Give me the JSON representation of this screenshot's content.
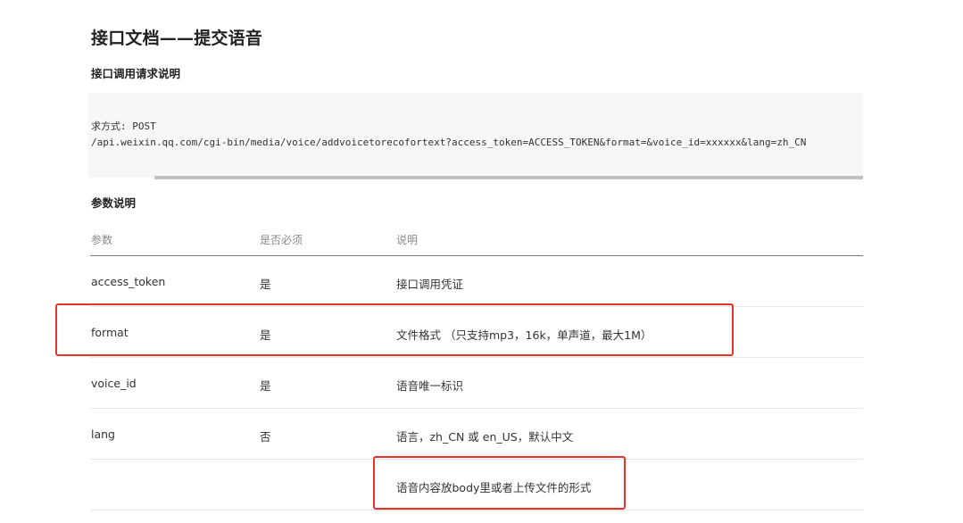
{
  "doc": {
    "title": "接口文档——提交语音",
    "request_section": {
      "heading": "接口调用请求说明",
      "code_lines": [
        "求方式: POST",
        "/api.weixin.qq.com/cgi-bin/media/voice/addvoicetorecofortext?access_token=ACCESS_TOKEN&format=&voice_id=xxxxxx&lang=zh_CN"
      ]
    },
    "params_section": {
      "heading": "参数说明",
      "columns": [
        "参数",
        "是否必须",
        "说明"
      ],
      "rows": [
        {
          "param": "access_token",
          "required": "是",
          "description": "接口调用凭证"
        },
        {
          "param": "format",
          "required": "是",
          "description": "文件格式 （只支持mp3，16k，单声道，最大1M）"
        },
        {
          "param": "voice_id",
          "required": "是",
          "description": "语音唯一标识"
        },
        {
          "param": "lang",
          "required": "否",
          "description": "语言，zh_CN 或 en_US，默认中文"
        },
        {
          "param": "",
          "required": "",
          "description": "语音内容放body里或者上传文件的形式"
        }
      ]
    }
  },
  "colors": {
    "highlight": "#e8332a",
    "code_background": "#f7f7f7",
    "header_text": "#888888"
  }
}
